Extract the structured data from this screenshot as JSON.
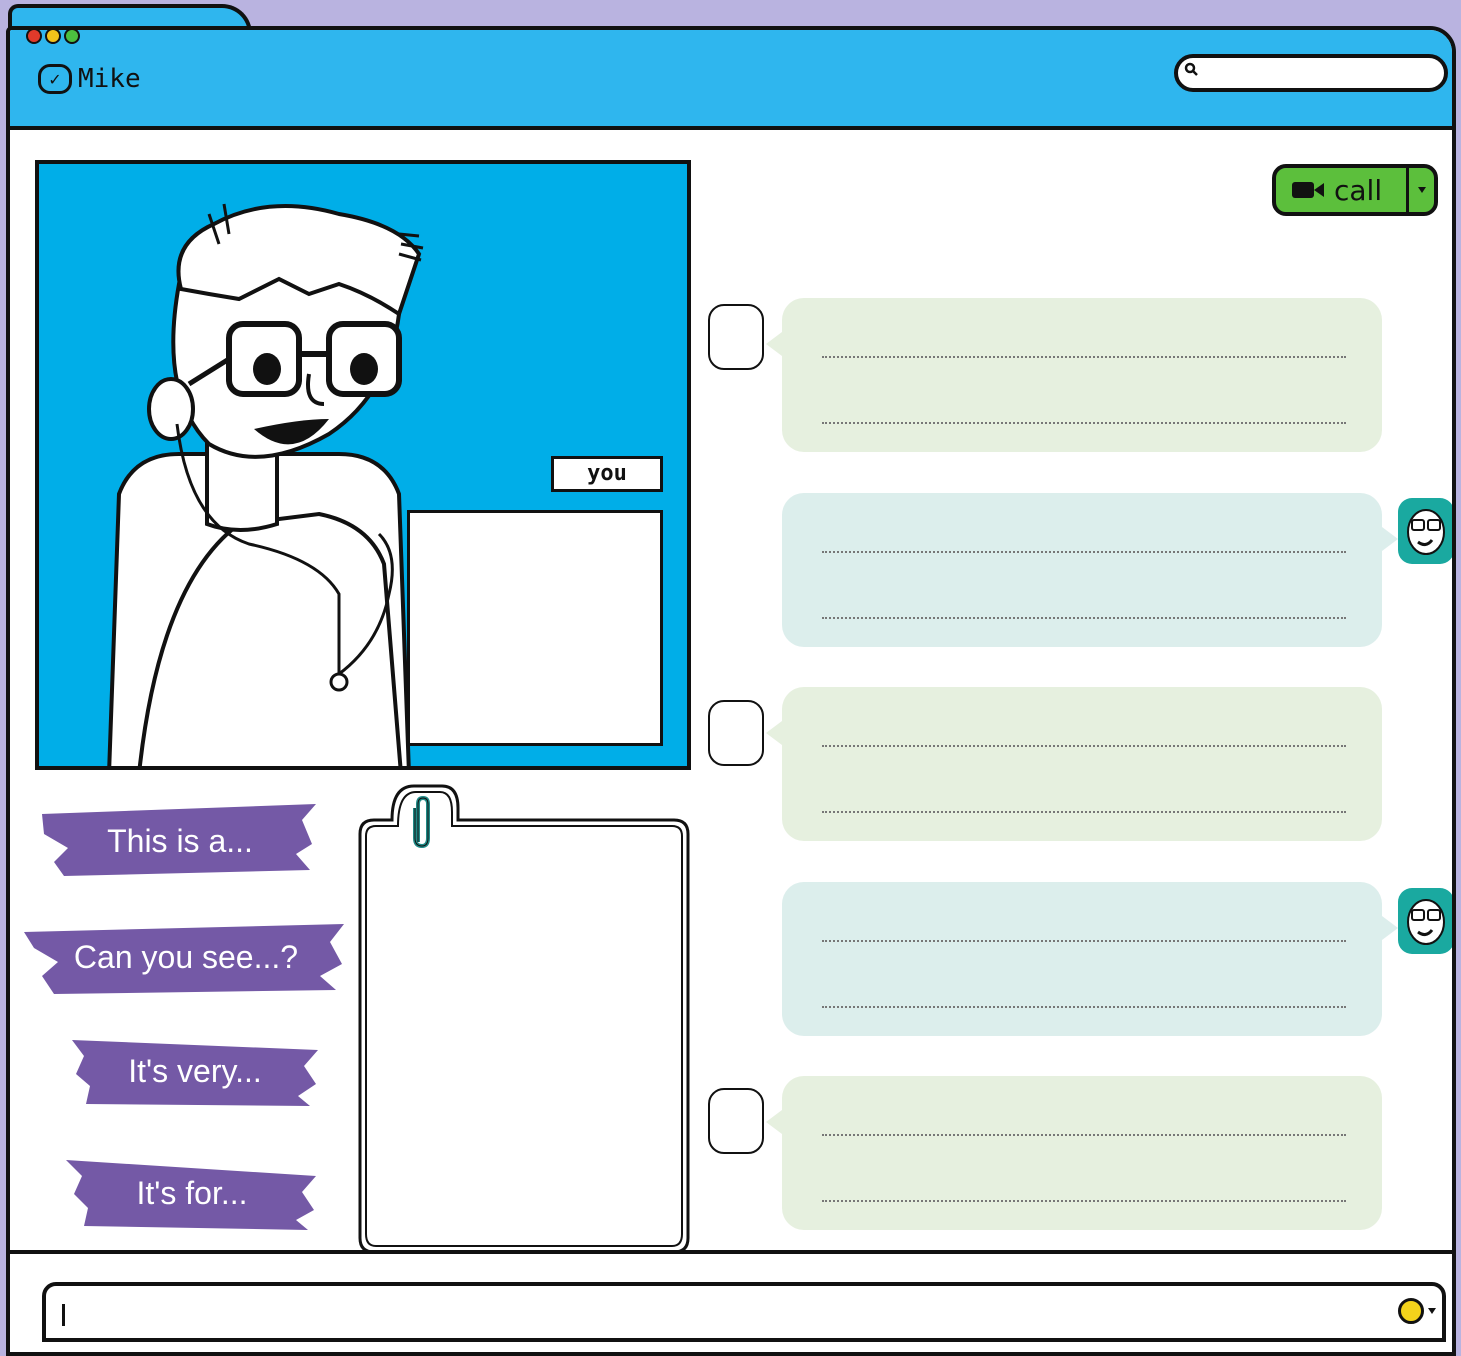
{
  "window": {
    "title": "Mike",
    "traffic_lights": [
      "#e03a2a",
      "#f2c21a",
      "#4cbf3f"
    ],
    "accent_color": "#2fb6ee"
  },
  "search": {
    "placeholder": "",
    "icon": "search-icon"
  },
  "video": {
    "label": "you",
    "background_color": "#00aee8"
  },
  "call_button": {
    "label": "call",
    "icon": "video-camera-icon",
    "color": "#5cbf3c"
  },
  "chat": {
    "messages": [
      {
        "sender": "user",
        "color": "#e6f0df"
      },
      {
        "sender": "mike",
        "color": "#dceeec"
      },
      {
        "sender": "user",
        "color": "#e6f0df"
      },
      {
        "sender": "mike",
        "color": "#dceeec"
      },
      {
        "sender": "user",
        "color": "#e6f0df"
      }
    ]
  },
  "phrases": [
    "This is a...",
    "Can you see...?",
    "It's very...",
    "It's for..."
  ],
  "phrase_color": "#7459a6",
  "attachment": {
    "icon": "paperclip-icon"
  },
  "composer": {
    "placeholder": "",
    "emoji_icon": "smiley-icon"
  }
}
